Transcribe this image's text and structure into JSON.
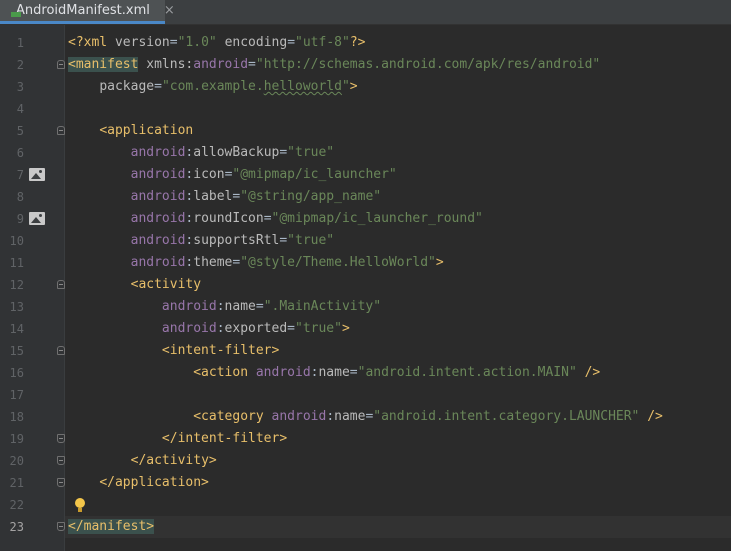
{
  "tab": {
    "title": "AndroidManifest.xml",
    "close_glyph": "×",
    "icon": "manifest-file-icon"
  },
  "editor": {
    "current_line": 23,
    "lines": [
      {
        "n": "1",
        "tokens": [
          [
            "pi",
            "<?xml "
          ],
          [
            "attr",
            "version"
          ],
          [
            "plain",
            "="
          ],
          [
            "val",
            "\"1.0\""
          ],
          [
            "plain",
            " "
          ],
          [
            "attr",
            "encoding"
          ],
          [
            "plain",
            "="
          ],
          [
            "val",
            "\"utf-8\""
          ],
          [
            "pi",
            "?>"
          ]
        ]
      },
      {
        "n": "2",
        "fold": "open",
        "tokens": [
          [
            "hl",
            "<manifest"
          ],
          [
            "plain",
            " "
          ],
          [
            "attr",
            "xmlns:"
          ],
          [
            "ns",
            "android"
          ],
          [
            "plain",
            "="
          ],
          [
            "val",
            "\"http://schemas.android.com/apk/res/android\""
          ]
        ]
      },
      {
        "n": "3",
        "tokens": [
          [
            "plain",
            "    "
          ],
          [
            "attr",
            "package"
          ],
          [
            "plain",
            "="
          ],
          [
            "val",
            "\"com.example."
          ],
          [
            "valsq",
            "helloworld"
          ],
          [
            "val",
            "\""
          ],
          [
            "tag",
            ">"
          ]
        ]
      },
      {
        "n": "4",
        "tokens": []
      },
      {
        "n": "5",
        "fold": "open",
        "tokens": [
          [
            "plain",
            "    "
          ],
          [
            "tag",
            "<application"
          ]
        ]
      },
      {
        "n": "6",
        "tokens": [
          [
            "plain",
            "        "
          ],
          [
            "ns",
            "android"
          ],
          [
            "plain",
            ":"
          ],
          [
            "attr",
            "allowBackup"
          ],
          [
            "plain",
            "="
          ],
          [
            "val",
            "\"true\""
          ]
        ]
      },
      {
        "n": "7",
        "img": true,
        "tokens": [
          [
            "plain",
            "        "
          ],
          [
            "ns",
            "android"
          ],
          [
            "plain",
            ":"
          ],
          [
            "attr",
            "icon"
          ],
          [
            "plain",
            "="
          ],
          [
            "val",
            "\"@mipmap/ic_launcher\""
          ]
        ]
      },
      {
        "n": "8",
        "tokens": [
          [
            "plain",
            "        "
          ],
          [
            "ns",
            "android"
          ],
          [
            "plain",
            ":"
          ],
          [
            "attr",
            "label"
          ],
          [
            "plain",
            "="
          ],
          [
            "val",
            "\"@string/app_name\""
          ]
        ]
      },
      {
        "n": "9",
        "img": true,
        "tokens": [
          [
            "plain",
            "        "
          ],
          [
            "ns",
            "android"
          ],
          [
            "plain",
            ":"
          ],
          [
            "attr",
            "roundIcon"
          ],
          [
            "plain",
            "="
          ],
          [
            "val",
            "\"@mipmap/ic_launcher_round\""
          ]
        ]
      },
      {
        "n": "10",
        "tokens": [
          [
            "plain",
            "        "
          ],
          [
            "ns",
            "android"
          ],
          [
            "plain",
            ":"
          ],
          [
            "attr",
            "supportsRtl"
          ],
          [
            "plain",
            "="
          ],
          [
            "val",
            "\"true\""
          ]
        ]
      },
      {
        "n": "11",
        "tokens": [
          [
            "plain",
            "        "
          ],
          [
            "ns",
            "android"
          ],
          [
            "plain",
            ":"
          ],
          [
            "attr",
            "theme"
          ],
          [
            "plain",
            "="
          ],
          [
            "val",
            "\"@style/Theme.HelloWorld\""
          ],
          [
            "tag",
            ">"
          ]
        ]
      },
      {
        "n": "12",
        "fold": "open",
        "tokens": [
          [
            "plain",
            "        "
          ],
          [
            "tag",
            "<activity"
          ]
        ]
      },
      {
        "n": "13",
        "tokens": [
          [
            "plain",
            "            "
          ],
          [
            "ns",
            "android"
          ],
          [
            "plain",
            ":"
          ],
          [
            "attr",
            "name"
          ],
          [
            "plain",
            "="
          ],
          [
            "val",
            "\".MainActivity\""
          ]
        ]
      },
      {
        "n": "14",
        "tokens": [
          [
            "plain",
            "            "
          ],
          [
            "ns",
            "android"
          ],
          [
            "plain",
            ":"
          ],
          [
            "attr",
            "exported"
          ],
          [
            "plain",
            "="
          ],
          [
            "val",
            "\"true\""
          ],
          [
            "tag",
            ">"
          ]
        ]
      },
      {
        "n": "15",
        "fold": "open",
        "tokens": [
          [
            "plain",
            "            "
          ],
          [
            "tag",
            "<intent-filter>"
          ]
        ]
      },
      {
        "n": "16",
        "tokens": [
          [
            "plain",
            "                "
          ],
          [
            "tag",
            "<action "
          ],
          [
            "ns",
            "android"
          ],
          [
            "plain",
            ":"
          ],
          [
            "attr",
            "name"
          ],
          [
            "plain",
            "="
          ],
          [
            "val",
            "\"android.intent.action.MAIN\""
          ],
          [
            "plain",
            " "
          ],
          [
            "tag",
            "/>"
          ]
        ]
      },
      {
        "n": "17",
        "tokens": []
      },
      {
        "n": "18",
        "tokens": [
          [
            "plain",
            "                "
          ],
          [
            "tag",
            "<category "
          ],
          [
            "ns",
            "android"
          ],
          [
            "plain",
            ":"
          ],
          [
            "attr",
            "name"
          ],
          [
            "plain",
            "="
          ],
          [
            "val",
            "\"android.intent.category.LAUNCHER\""
          ],
          [
            "plain",
            " "
          ],
          [
            "tag",
            "/>"
          ]
        ]
      },
      {
        "n": "19",
        "fold": "close",
        "tokens": [
          [
            "plain",
            "            "
          ],
          [
            "tag",
            "</intent-filter>"
          ]
        ]
      },
      {
        "n": "20",
        "fold": "close",
        "tokens": [
          [
            "plain",
            "        "
          ],
          [
            "tag",
            "</activity>"
          ]
        ]
      },
      {
        "n": "21",
        "fold": "close",
        "tokens": [
          [
            "plain",
            "    "
          ],
          [
            "tag",
            "</application>"
          ]
        ]
      },
      {
        "n": "22",
        "bulb": true,
        "tokens": []
      },
      {
        "n": "23",
        "fold": "close",
        "tokens": [
          [
            "hl",
            "</manifest>"
          ]
        ]
      }
    ]
  },
  "colors": {
    "background": "#2b2b2b",
    "gutter": "#313335",
    "tag": "#e8bf6a",
    "attribute": "#bababa",
    "namespace": "#9876aa",
    "value": "#6a8759",
    "tag_highlight": "#3b514d",
    "tab_accent": "#4a88c7"
  }
}
